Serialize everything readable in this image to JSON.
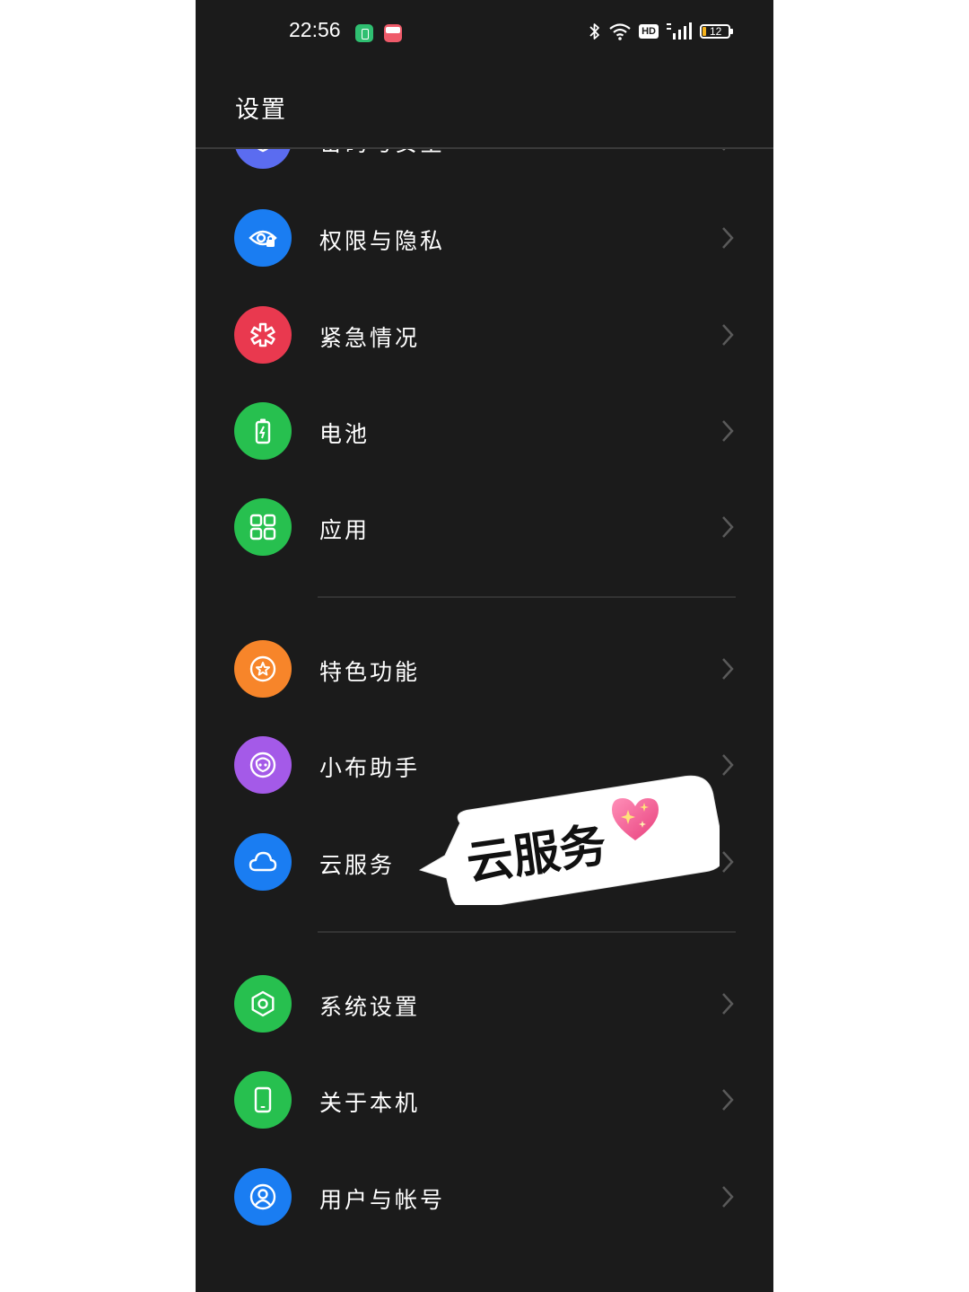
{
  "status_bar": {
    "time": "22:56",
    "network_badge": "HD",
    "battery_level": "12"
  },
  "header": {
    "title": "设置"
  },
  "menu": {
    "items": [
      {
        "label": "密码与安全",
        "icon": "shield-icon",
        "color": "#5b6cf0"
      },
      {
        "label": "权限与隐私",
        "icon": "privacy-eye-icon",
        "color": "#1a7df2"
      },
      {
        "label": "紧急情况",
        "icon": "emergency-asterisk-icon",
        "color": "#e9394f"
      },
      {
        "label": "电池",
        "icon": "battery-icon",
        "color": "#27c04f"
      },
      {
        "label": "应用",
        "icon": "apps-grid-icon",
        "color": "#27c04f"
      },
      {
        "label": "特色功能",
        "icon": "star-badge-icon",
        "color": "#f7852a"
      },
      {
        "label": "小布助手",
        "icon": "assistant-icon",
        "color": "#a45ae8"
      },
      {
        "label": "云服务",
        "icon": "cloud-icon",
        "color": "#1a7df2"
      },
      {
        "label": "系统设置",
        "icon": "system-hexagon-icon",
        "color": "#27c04f"
      },
      {
        "label": "关于本机",
        "icon": "phone-icon",
        "color": "#27c04f"
      },
      {
        "label": "用户与帐号",
        "icon": "user-account-icon",
        "color": "#1a7df2"
      }
    ]
  },
  "sticker": {
    "text": "云服务"
  },
  "colors": {
    "background": "#1b1b1b",
    "text": "#ffffff",
    "chevron": "#5a5a5a",
    "divider": "#333333"
  }
}
